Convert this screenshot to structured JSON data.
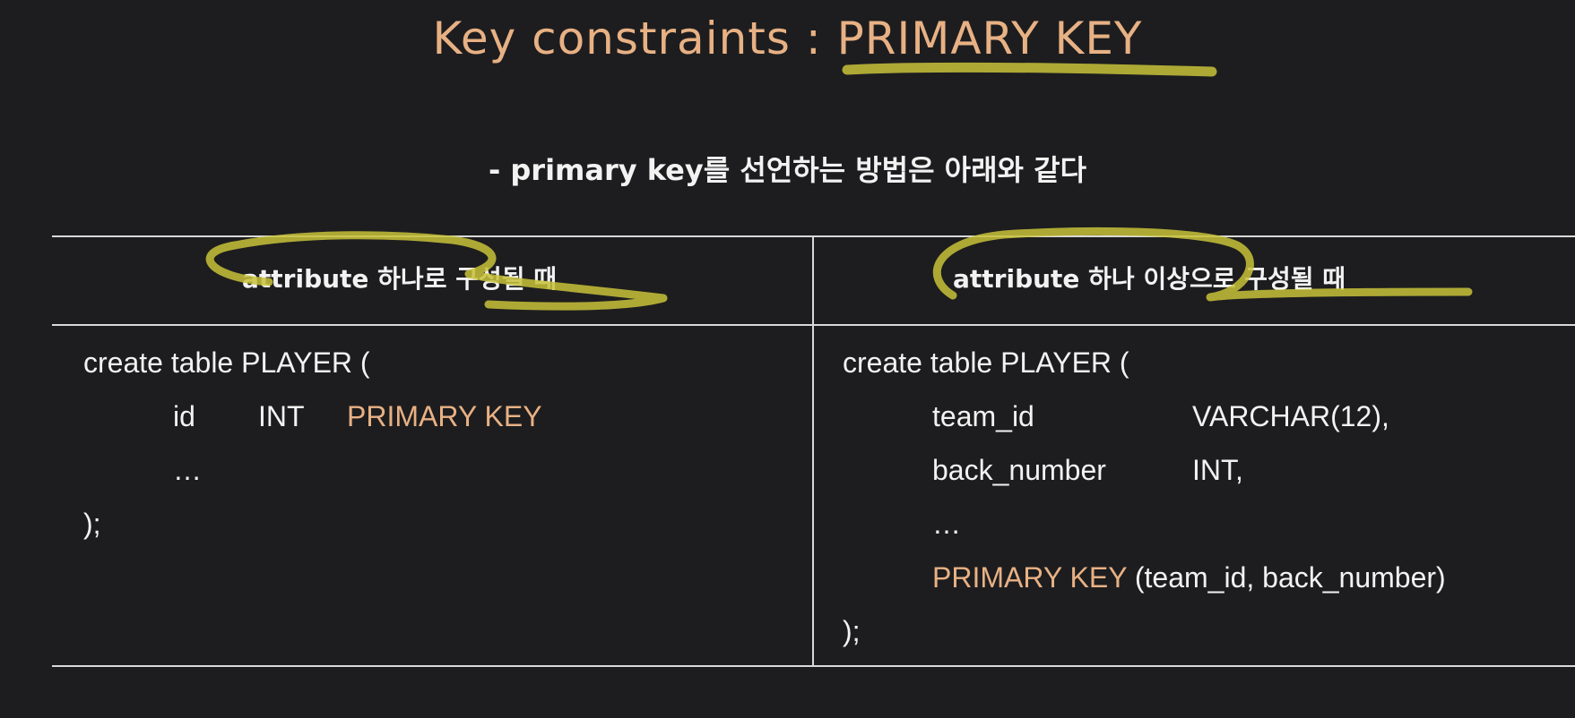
{
  "title": {
    "prefix": "Key constraints : ",
    "highlight": "PRIMARY KEY"
  },
  "subtitle": "- primary key를 선언하는 방법은 아래와 같다",
  "table": {
    "headers": [
      "attribute 하나로 구성될 때",
      "attribute 하나 이상으로 구성될 때"
    ],
    "left_code": {
      "line1": "create table PLAYER (",
      "line2_col1": "id",
      "line2_col2": "INT",
      "line2_kw": "PRIMARY KEY",
      "line3": "…",
      "line4": ");"
    },
    "right_code": {
      "line1": "create table PLAYER (",
      "line2_col1": "team_id",
      "line2_col2": "VARCHAR(12),",
      "line3_col1": "back_number",
      "line3_col2": "INT,",
      "line4": "…",
      "line5_kw": "PRIMARY KEY",
      "line5_rest": " (team_id, back_number)",
      "line6": ");"
    }
  },
  "colors": {
    "background": "#1d1d1f",
    "accent": "#e8b184",
    "highlight_marker": "#c8c23a"
  }
}
